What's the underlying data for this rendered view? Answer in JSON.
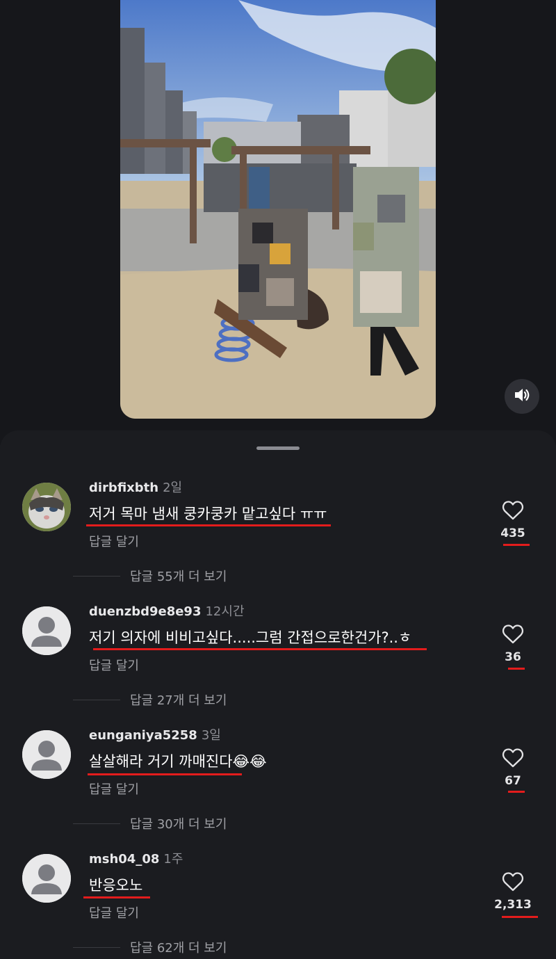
{
  "icons": {
    "sound": "speaker-icon",
    "like": "heart-outline-icon"
  },
  "colors": {
    "background": "#1b1c20",
    "annotation_underline": "#e31c1c"
  },
  "comments": [
    {
      "username": "dirbfixbth",
      "time": "2일",
      "text": "저거 목마 냄새 쿵카쿵카 맡고싶다 ㅠㅠ",
      "reply_label": "답글 달기",
      "likes": "435",
      "view_replies": "답글 55개 더 보기",
      "avatar": "cat-photo"
    },
    {
      "username": "duenzbd9e8e93",
      "time": "12시간",
      "text": "저기 의자에 비비고싶다.....그럼 간접으로한건가?..ㅎ",
      "reply_label": "답글 달기",
      "likes": "36",
      "view_replies": "답글 27개 더 보기",
      "avatar": "default-user"
    },
    {
      "username": "eunganiya5258",
      "time": "3일",
      "text": "살살해라 거기 까매진다😂😂",
      "reply_label": "답글 달기",
      "likes": "67",
      "view_replies": "답글 30개 더 보기",
      "avatar": "default-user"
    },
    {
      "username": "msh04_08",
      "time": "1주",
      "text": "반응오노",
      "reply_label": "답글 달기",
      "likes": "2,313",
      "view_replies": "답글 62개 더 보기",
      "avatar": "default-user"
    }
  ]
}
